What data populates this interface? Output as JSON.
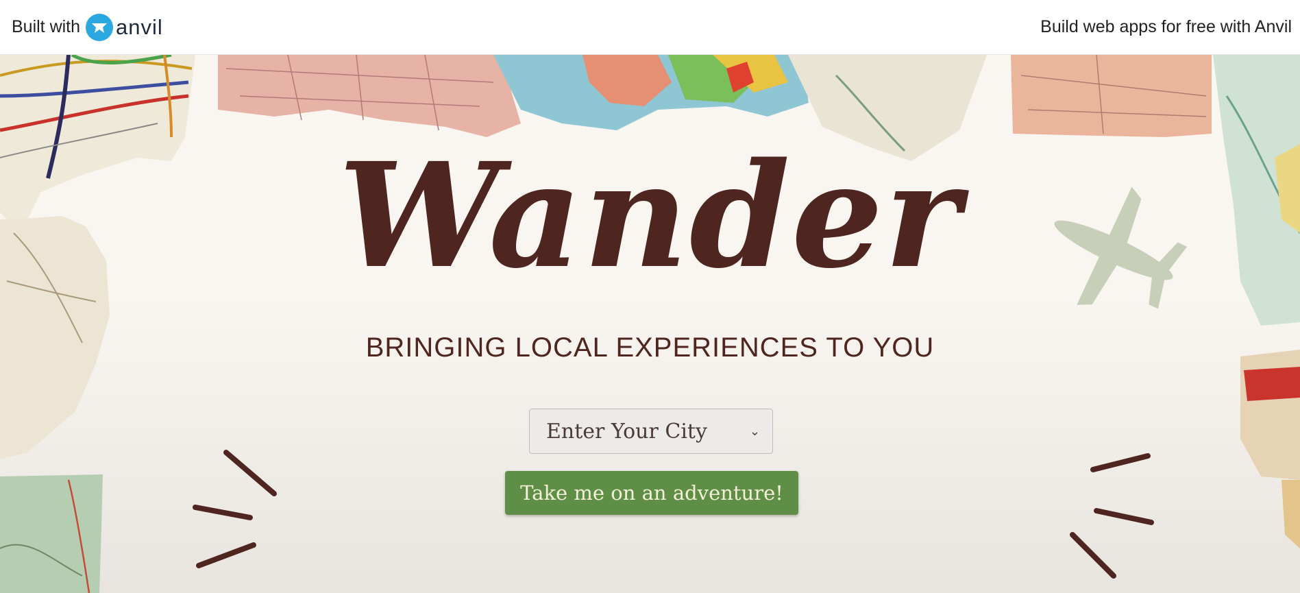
{
  "topbar": {
    "built_with": "Built with",
    "logo_text": "anvil",
    "promo_link": "Build web apps for free with Anvil"
  },
  "hero": {
    "title": "Wander",
    "subtitle": "BRINGING LOCAL EXPERIENCES TO YOU",
    "city_select": {
      "placeholder": "Enter Your City"
    },
    "adventure_button": "Take me on an adventure!"
  },
  "colors": {
    "brand_brown": "#4f2520",
    "button_green": "#5f8f47",
    "anvil_blue": "#2ba8e0",
    "background": "#f8f5f0"
  },
  "icons": [
    "anvil-logo-icon",
    "chevron-down-icon",
    "airplane-icon"
  ]
}
